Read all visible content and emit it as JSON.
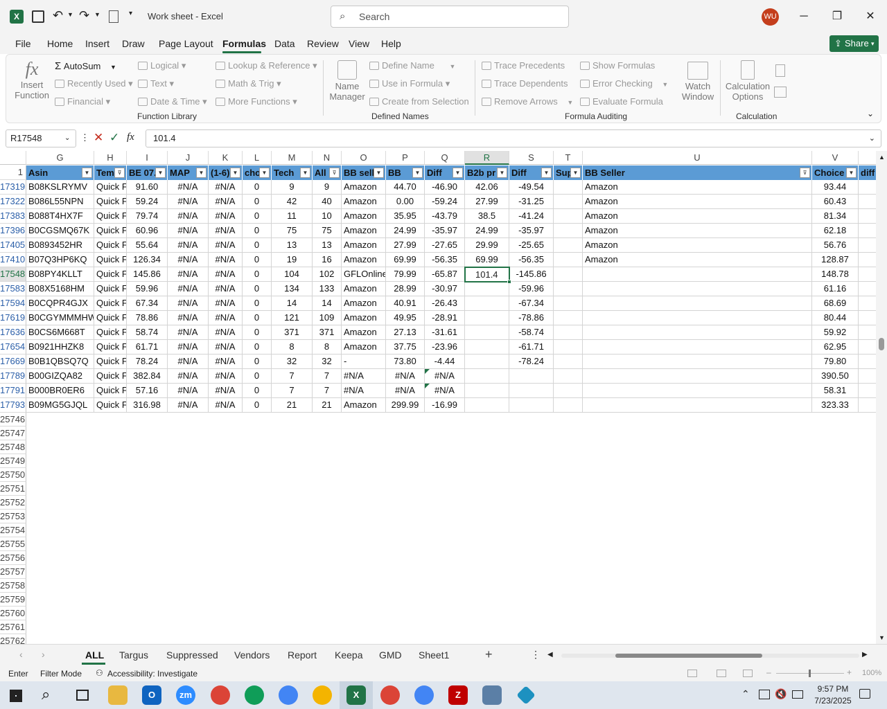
{
  "title": "Work sheet  -  Excel",
  "search_placeholder": "Search",
  "avatar": "WU",
  "window": {
    "min": "─",
    "max": "❐",
    "close": "✕"
  },
  "menu": [
    "File",
    "Home",
    "Insert",
    "Draw",
    "Page Layout",
    "Formulas",
    "Data",
    "Review",
    "View",
    "Help"
  ],
  "share": "Share",
  "ribbon": {
    "insert_function": [
      "Insert",
      "Function"
    ],
    "autosum": "AutoSum",
    "recently_used": "Recently Used",
    "financial": "Financial",
    "logical": "Logical",
    "text": "Text",
    "date_time": "Date & Time",
    "lookup": "Lookup & Reference",
    "math": "Math & Trig",
    "more": "More Functions",
    "function_library": "Function Library",
    "name_manager": [
      "Name",
      "Manager"
    ],
    "define_name": "Define Name",
    "use_in_formula": "Use in Formula",
    "create_from_selection": "Create from Selection",
    "defined_names": "Defined Names",
    "trace_precedents": "Trace Precedents",
    "trace_dependents": "Trace Dependents",
    "remove_arrows": "Remove Arrows",
    "show_formulas": "Show Formulas",
    "error_checking": "Error Checking",
    "evaluate_formula": "Evaluate Formula",
    "watch_window": [
      "Watch",
      "Window"
    ],
    "formula_auditing": "Formula Auditing",
    "calc_options": [
      "Calculation",
      "Options"
    ],
    "calculation": "Calculation"
  },
  "namebox": "R17548",
  "formula_value": "101.4",
  "columns": [
    "G",
    "H",
    "I",
    "J",
    "K",
    "L",
    "M",
    "N",
    "O",
    "P",
    "Q",
    "R",
    "S",
    "T",
    "U",
    "V"
  ],
  "headers": [
    "Asin",
    "Tem",
    "BE 07.",
    "MAP",
    "(1-6)",
    "cho",
    "Tech",
    "All",
    "BB sell",
    "BB",
    "Diff",
    "B2b pr",
    "Diff",
    "Sup",
    "BB Seller",
    "Choice",
    "diff"
  ],
  "rows": [
    {
      "r": "17319",
      "v": [
        "B08KSLRYMV",
        "Quick F",
        "91.60",
        "#N/A",
        "#N/A",
        "0",
        "9",
        "9",
        "Amazon",
        "44.70",
        "-46.90",
        "42.06",
        "-49.54",
        "",
        "Amazon",
        "93.44"
      ]
    },
    {
      "r": "17322",
      "v": [
        "B086L55NPN",
        "Quick F",
        "59.24",
        "#N/A",
        "#N/A",
        "0",
        "42",
        "40",
        "Amazon",
        "0.00",
        "-59.24",
        "27.99",
        "-31.25",
        "",
        "Amazon",
        "60.43"
      ]
    },
    {
      "r": "17383",
      "v": [
        "B088T4HX7F",
        "Quick F",
        "79.74",
        "#N/A",
        "#N/A",
        "0",
        "11",
        "10",
        "Amazon",
        "35.95",
        "-43.79",
        "38.5",
        "-41.24",
        "",
        "Amazon",
        "81.34"
      ]
    },
    {
      "r": "17396",
      "v": [
        "B0CGSMQ67K",
        "Quick F",
        "60.96",
        "#N/A",
        "#N/A",
        "0",
        "75",
        "75",
        "Amazon",
        "24.99",
        "-35.97",
        "24.99",
        "-35.97",
        "",
        "Amazon",
        "62.18"
      ]
    },
    {
      "r": "17405",
      "v": [
        "B0893452HR",
        "Quick F",
        "55.64",
        "#N/A",
        "#N/A",
        "0",
        "13",
        "13",
        "Amazon",
        "27.99",
        "-27.65",
        "29.99",
        "-25.65",
        "",
        "Amazon",
        "56.76"
      ]
    },
    {
      "r": "17410",
      "v": [
        "B07Q3HP6KQ",
        "Quick F",
        "126.34",
        "#N/A",
        "#N/A",
        "0",
        "19",
        "16",
        "Amazon",
        "69.99",
        "-56.35",
        "69.99",
        "-56.35",
        "",
        "Amazon",
        "128.87"
      ]
    },
    {
      "r": "17548",
      "v": [
        "B08PY4KLLT",
        "Quick F",
        "145.86",
        "#N/A",
        "#N/A",
        "0",
        "104",
        "102",
        "GFLOnline",
        "79.99",
        "-65.87",
        "101.4",
        "-145.86",
        "",
        "",
        "148.78"
      ]
    },
    {
      "r": "17583",
      "v": [
        "B08X5168HM",
        "Quick F",
        "59.96",
        "#N/A",
        "#N/A",
        "0",
        "134",
        "133",
        "Amazon",
        "28.99",
        "-30.97",
        "",
        "-59.96",
        "",
        "",
        "61.16"
      ]
    },
    {
      "r": "17594",
      "v": [
        "B0CQPR4GJX",
        "Quick F",
        "67.34",
        "#N/A",
        "#N/A",
        "0",
        "14",
        "14",
        "Amazon",
        "40.91",
        "-26.43",
        "",
        "-67.34",
        "",
        "",
        "68.69"
      ]
    },
    {
      "r": "17619",
      "v": [
        "B0CGYMMMHW",
        "Quick F",
        "78.86",
        "#N/A",
        "#N/A",
        "0",
        "121",
        "109",
        "Amazon",
        "49.95",
        "-28.91",
        "",
        "-78.86",
        "",
        "",
        "80.44"
      ]
    },
    {
      "r": "17636",
      "v": [
        "B0CS6M668T",
        "Quick F",
        "58.74",
        "#N/A",
        "#N/A",
        "0",
        "371",
        "371",
        "Amazon",
        "27.13",
        "-31.61",
        "",
        "-58.74",
        "",
        "",
        "59.92"
      ]
    },
    {
      "r": "17654",
      "v": [
        "B0921HHZK8",
        "Quick F",
        "61.71",
        "#N/A",
        "#N/A",
        "0",
        "8",
        "8",
        "Amazon",
        "37.75",
        "-23.96",
        "",
        "-61.71",
        "",
        "",
        "62.95"
      ]
    },
    {
      "r": "17669",
      "v": [
        "B0B1QBSQ7Q",
        "Quick F",
        "78.24",
        "#N/A",
        "#N/A",
        "0",
        "32",
        "32",
        "-",
        "73.80",
        "-4.44",
        "",
        "-78.24",
        "",
        "",
        "79.80"
      ]
    },
    {
      "r": "17789",
      "v": [
        "B00GIZQA82",
        "Quick F",
        "382.84",
        "#N/A",
        "#N/A",
        "0",
        "7",
        "7",
        "#N/A",
        "#N/A",
        "#N/A",
        "",
        "",
        "",
        "",
        "390.50"
      ]
    },
    {
      "r": "17791",
      "v": [
        "B000BR0ER6",
        "Quick F",
        "57.16",
        "#N/A",
        "#N/A",
        "0",
        "7",
        "7",
        "#N/A",
        "#N/A",
        "#N/A",
        "",
        "",
        "",
        "",
        "58.31"
      ]
    },
    {
      "r": "17793",
      "v": [
        "B09MG5GJQL",
        "Quick F",
        "316.98",
        "#N/A",
        "#N/A",
        "0",
        "21",
        "21",
        "Amazon",
        "299.99",
        "-16.99",
        "",
        "",
        "",
        "",
        "323.33"
      ]
    }
  ],
  "empty_rows": [
    "25746",
    "25747",
    "25748",
    "25749",
    "25750",
    "25751",
    "25752",
    "25753",
    "25754",
    "25755",
    "25756",
    "25757",
    "25758",
    "25759",
    "25760",
    "25761",
    "25762"
  ],
  "sheets": [
    "ALL",
    "Targus",
    "Suppressed",
    "Vendors",
    "Report",
    "Keepa",
    "GMD",
    "Sheet1"
  ],
  "status": {
    "mode": "Enter",
    "filter": "Filter Mode",
    "accessibility": "Accessibility: Investigate",
    "zoom": "100%"
  },
  "clock": {
    "time": "9:57 PM",
    "date": "7/23/2025"
  },
  "colors": {
    "excel_green": "#217346",
    "table_header": "#5b9bd5",
    "row_link": "#2a5ea8"
  }
}
